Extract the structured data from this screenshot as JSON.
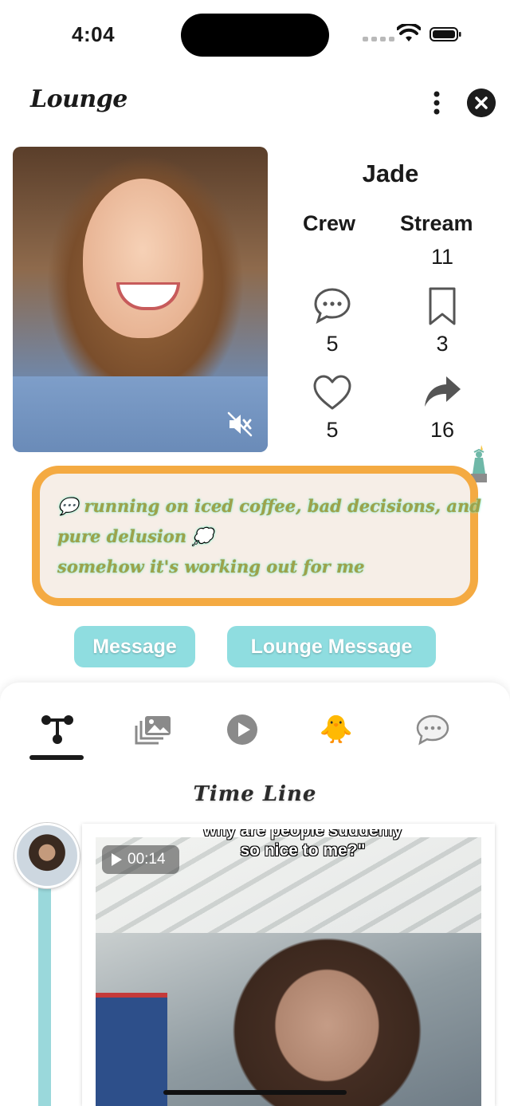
{
  "status_bar": {
    "time": "4:04"
  },
  "header": {
    "brand": "Lounge",
    "more_icon": "vertical-dots-icon",
    "close_icon": "close-icon"
  },
  "profile": {
    "name": "Jade",
    "crew_label": "Crew",
    "stream_label": "Stream",
    "crew_count": "",
    "stream_count": "11",
    "comments_count": "5",
    "bookmarks_count": "3",
    "likes_count": "5",
    "shares_count": "16"
  },
  "bio": {
    "line1": "💬 running on iced coffee, bad decisions, and",
    "line2": "pure delusion 💭",
    "line3": "somehow it's working out for me"
  },
  "actions": {
    "message": "Message",
    "lounge_message": "Lounge Message"
  },
  "tabs": [
    {
      "name": "network-icon",
      "active": true
    },
    {
      "name": "photos-icon",
      "active": false
    },
    {
      "name": "play-icon",
      "active": false
    },
    {
      "name": "chick-icon",
      "active": false,
      "glyph": "🐥"
    },
    {
      "name": "chat-icon",
      "active": false
    }
  ],
  "timeline": {
    "title": "Time Line",
    "post": {
      "duration": "00:14",
      "caption_top": "why are people suddenly",
      "caption_bottom": "so nice to me?\""
    }
  },
  "colors": {
    "accent_teal": "#8fdde0",
    "bio_border": "#f4aa42",
    "bio_bg": "#f6eee7",
    "bio_text": "#9ea24a"
  }
}
